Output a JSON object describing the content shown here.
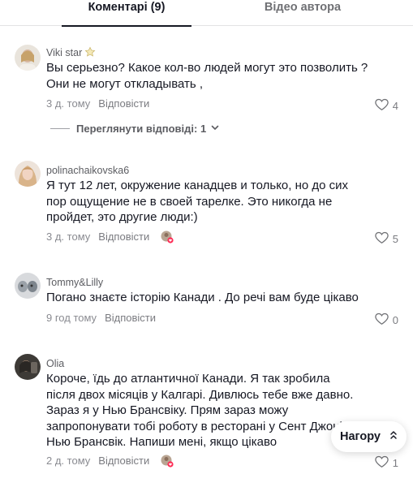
{
  "tabs": {
    "comments": "Коментарі (9)",
    "author_videos": "Відео автора"
  },
  "comments": [
    {
      "username": "Viki star",
      "text": "Вы серьезно? Какое кол-во людей могут это позволить ? Они не могут откладывать ,",
      "time": "3 д. тому",
      "reply": "Відповісти",
      "likes": "4"
    },
    {
      "username": "polinachaikovska6",
      "text": "Я тут 12 лет, окружение канадцев и только, но до сих пор ощущение не в своей тарелке. Это никогда не пройдет, это другие люди:)",
      "time": "3 д. тому",
      "reply": "Відповісти",
      "likes": "5"
    },
    {
      "username": "Tommy&Lilly",
      "text": "Погано знаєте історію Канади . До речі вам буде цікаво",
      "time": "9 год тому",
      "reply": "Відповісти",
      "likes": "0"
    },
    {
      "username": "Olia",
      "text": "Короче, їдь до атлантичної Канади. Я так зробила після двох місяців у Калгарі. Дивлюсь тебе вже давно. Зараз я у Нью Брансвіку. Прям зараз можу запропонувати тобі роботу в ресторані у Сент Джоні , Нью Брансвік. Напиши мені, якщо цікаво",
      "time": "2 д. тому",
      "reply": "Відповісти",
      "likes": "1"
    }
  ],
  "view_replies": "Переглянути відповіді: 1",
  "scroll_top": "Нагору",
  "colors": {
    "text": "#161823",
    "muted": "#8a8b91",
    "creator_badge": "#fe2c55"
  },
  "icons": [
    "star-icon",
    "heart-icon",
    "chevron-down-icon",
    "creator-liked-icon",
    "chevron-up-icon"
  ]
}
